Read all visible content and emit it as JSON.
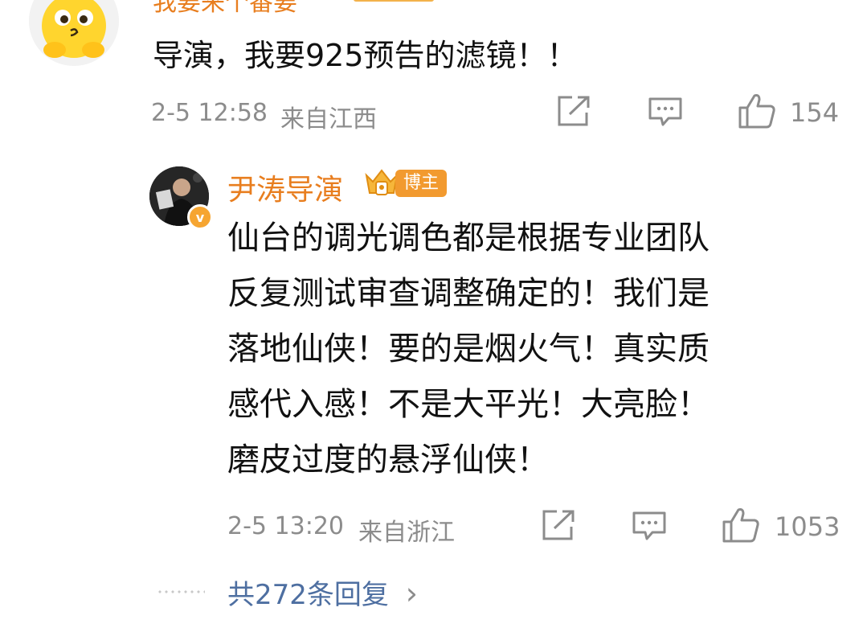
{
  "top_comment": {
    "username": "我要来个番要",
    "text": "导演，我要925预告的滤镜！！",
    "time": "2-5 12:58",
    "location": "来自江西",
    "likes": "154",
    "icons": [
      "share-icon",
      "comment-icon",
      "like-icon"
    ]
  },
  "reply": {
    "username": "尹涛导演",
    "host_badge": "博主",
    "lines": [
      "仙台的调光调色都是根据专业团队",
      "反复测试审查调整确定的！我们是",
      "落地仙侠！要的是烟火气！真实质",
      "感代入感！不是大平光！大亮脸！",
      "磨皮过度的悬浮仙侠！"
    ],
    "time": "2-5 13:20",
    "location": "来自浙江",
    "likes": "1053"
  },
  "more_replies": {
    "label": "共272条回复",
    "chevron": "›"
  },
  "colors": {
    "username": "#e87e1f",
    "meta": "#8c8c8c",
    "link": "#4e6fa1",
    "badge": "#f29a2f"
  }
}
